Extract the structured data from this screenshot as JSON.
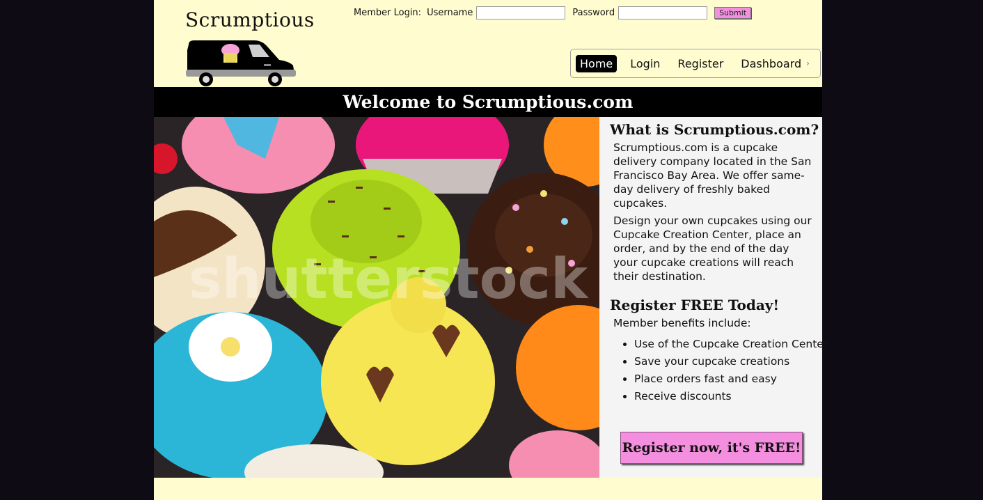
{
  "brand": {
    "name": "Scrumptious",
    "logo_icon": "delivery-van-icon"
  },
  "login": {
    "label": "Member Login:",
    "username_label": "Username",
    "username_value": "",
    "password_label": "Password",
    "password_value": "",
    "submit_label": "Submit"
  },
  "nav": {
    "items": [
      {
        "label": "Home",
        "active": true
      },
      {
        "label": "Login"
      },
      {
        "label": "Register"
      },
      {
        "label": "Dashboard"
      }
    ],
    "more_icon": "chevron-right-icon"
  },
  "banner": {
    "title": "Welcome to Scrumptious.com"
  },
  "hero": {
    "alt": "cupcakes-photo",
    "watermark": "shutterstock"
  },
  "about": {
    "heading": "What is Scrumptious.com?",
    "para1": "Scrumptious.com is a cupcake delivery company located in the San Francisco Bay Area. We offer same-day delivery of freshly baked cupcakes.",
    "para2": "Design your own cupcakes using our Cupcake Creation Center, place an order, and by the end of the day your cupcake creations will reach their destination."
  },
  "register": {
    "heading": "Register FREE Today!",
    "intro": "Member benefits include:",
    "benefits": [
      "Use of the Cupcake Creation Center",
      "Save your cupcake creations",
      "Place orders fast and easy",
      "Receive discounts"
    ],
    "cta_label": "Register now, it's FREE!"
  },
  "colors": {
    "background": "#fffdd0",
    "accent": "#f48fe0",
    "banner": "#000000"
  }
}
